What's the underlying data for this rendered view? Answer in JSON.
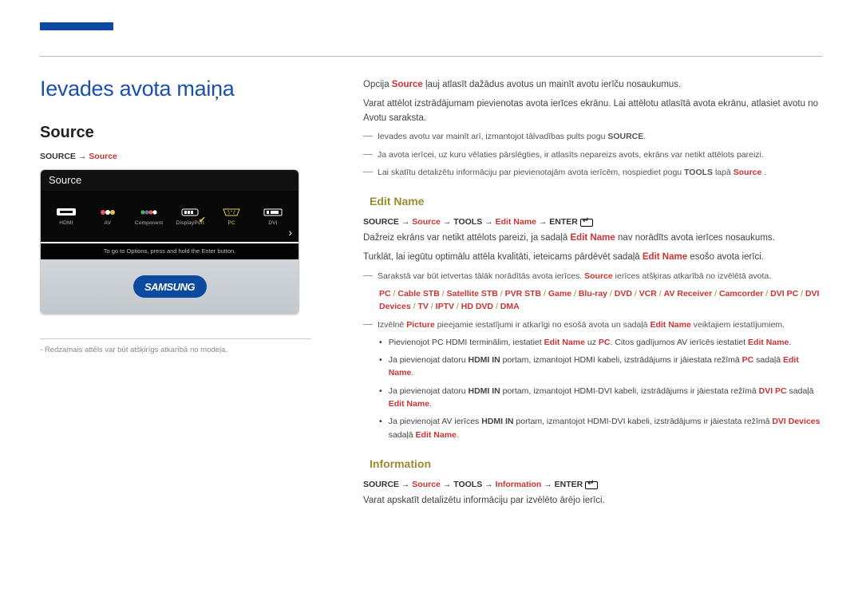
{
  "title": "Ievades avota maiņa",
  "source_heading": "Source",
  "breadcrumb_source": {
    "k1": "SOURCE",
    "arrow": " → ",
    "k2": "Source"
  },
  "tv_screen": {
    "title": "Source",
    "ports": [
      "HDMI",
      "AV",
      "Component",
      "DisplayPort",
      "PC",
      "DVI"
    ],
    "help": "To go to Options, press and hold the Enter button.",
    "logo": "SAMSUNG"
  },
  "img_caption_dash": "-",
  "img_caption": "Redzamais attēls var būt atšķirīgs atkarībā no modeļa.",
  "intro": {
    "p1a": "Opcija ",
    "p1k": "Source",
    "p1b": " ļauj atlasīt dažādus avotus un mainīt avotu ierīču nosaukumus.",
    "p2": "Varat attēlot izstrādājumam pievienotas avota ierīces ekrānu. Lai attēlotu atlasītā avota ekrānu, atlasiet avotu no Avotu saraksta.",
    "n1a": "Ievades avotu var mainīt arī, izmantojot tālvadības pults pogu ",
    "n1k": "SOURCE",
    "n1b": ".",
    "n2": "Ja avota ierīcei, uz kuru vēlaties pārslēgties, ir atlasīts nepareizs avots, ekrāns var netikt attēlots pareizi.",
    "n3a": "Lai skatītu detalizētu informāciju par pievienotajām avota ierīcēm, nospiediet pogu ",
    "n3k1": "TOOLS",
    "n3b": " lapā ",
    "n3k2": "Source",
    "n3c": " ."
  },
  "editname": {
    "head": "Edit Name",
    "bc": {
      "k1": "SOURCE",
      "a": " → ",
      "k2": "Source",
      "k3": "TOOLS",
      "k4": "Edit Name",
      "k5": "ENTER"
    },
    "p1a": "Dažreiz ekrāns var netikt attēlots pareizi, ja sadaļā ",
    "p1k": "Edit Name",
    "p1b": " nav norādīts avota ierīces nosaukums.",
    "p2a": "Turklāt, lai iegūtu optimālu attēla kvalitāti, ieteicams pārdēvēt sadaļā ",
    "p2k": "Edit Name",
    "p2b": " esošo avota ierīci.",
    "note1a": "Sarakstā var būt ietvertas tālāk norādītās avota ierīces. ",
    "note1k": "Source",
    "note1b": " ierīces atšķiras atkarībā no izvēlētā avota.",
    "devices": [
      "PC",
      "Cable STB",
      "Satellite STB",
      "PVR STB",
      "Game",
      "Blu-ray",
      "DVD",
      "VCR",
      "AV Receiver",
      "Camcorder",
      "DVI PC",
      "DVI Devices",
      "TV",
      "IPTV",
      "HD DVD",
      "DMA"
    ],
    "sep": " / ",
    "note2a": "Izvēlnē ",
    "note2k1": "Picture",
    "note2b": " pieejamie iestatījumi ir atkarīgi no esošā avota un sadaļā ",
    "note2k2": "Edit Name",
    "note2c": " veiktajiem iestatījumiem.",
    "b1a": "Pievienojot PC HDMI terminālim, iestatiet ",
    "b1k1": "Edit Name",
    "b1b": " uz ",
    "b1k2": "PC",
    "b1c": ". Citos gadījumos AV ierīcēs iestatiet ",
    "b1k3": "Edit Name",
    "b1d": ".",
    "b2a": "Ja pievienojat datoru ",
    "b2k0": "HDMI IN",
    "b2b": " portam, izmantojot HDMI kabeli, izstrādājums ir jāiestata režīmā ",
    "b2k1": "PC",
    "b2c": " sadaļā ",
    "b2k2": "Edit Name",
    "b2d": ".",
    "b3a": "Ja pievienojat datoru ",
    "b3k0": "HDMI IN",
    "b3b": " portam, izmantojot HDMI-DVI kabeli, izstrādājums ir jāiestata režīmā ",
    "b3k1": "DVI PC",
    "b3c": " sadaļā ",
    "b3k2": "Edit Name",
    "b3d": ".",
    "b4a": "Ja pievienojat AV ierīces ",
    "b4k0": "HDMI IN",
    "b4b": " portam, izmantojot HDMI-DVI kabeli, izstrādājums ir jāiestata režīmā ",
    "b4k1": "DVI Devices",
    "b4c": " sadaļā ",
    "b4k2": "Edit Name",
    "b4d": "."
  },
  "info": {
    "head": "Information",
    "bc": {
      "k1": "SOURCE",
      "a": " → ",
      "k2": "Source",
      "k3": "TOOLS",
      "k4": "Information",
      "k5": "ENTER"
    },
    "p1": "Varat apskatīt detalizētu informāciju par izvēlēto ārējo ierīci."
  }
}
